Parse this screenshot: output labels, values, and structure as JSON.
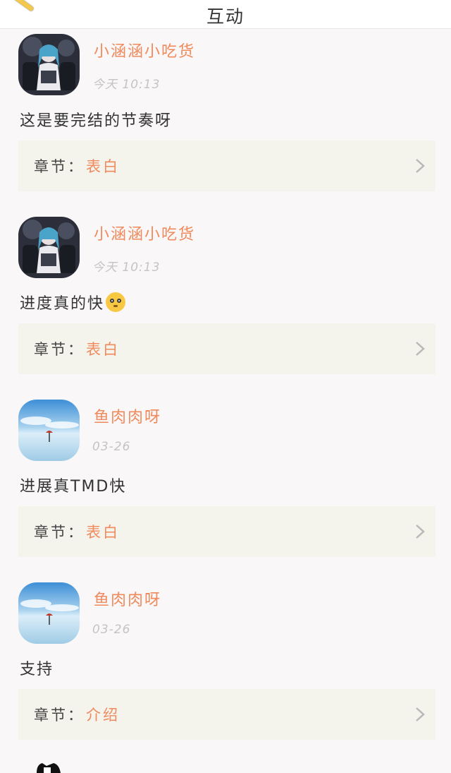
{
  "header": {
    "title": "互动",
    "back_icon": "pencil-icon"
  },
  "chapter_label": "章节：",
  "comments": [
    {
      "user": "小涵涵小吃货",
      "time": "今天 10:13",
      "text": "这是要完结的节奏呀",
      "emoji": "",
      "chapter": "表白",
      "avatar": "anime-girl-avatar"
    },
    {
      "user": "小涵涵小吃货",
      "time": "今天 10:13",
      "text": "进度真的快",
      "emoji": "blush-emoji",
      "chapter": "表白",
      "avatar": "anime-girl-avatar"
    },
    {
      "user": "鱼肉肉呀",
      "time": "03-26",
      "text": "进展真TMD快",
      "emoji": "",
      "chapter": "表白",
      "avatar": "sky-umbrella-avatar"
    },
    {
      "user": "鱼肉肉呀",
      "time": "03-26",
      "text": "支持",
      "emoji": "",
      "chapter": "介绍",
      "avatar": "sky-umbrella-avatar"
    }
  ],
  "colors": {
    "accent": "#f08a5d",
    "background": "#f9f7f7",
    "chapter_bg": "#f4f3ec"
  }
}
